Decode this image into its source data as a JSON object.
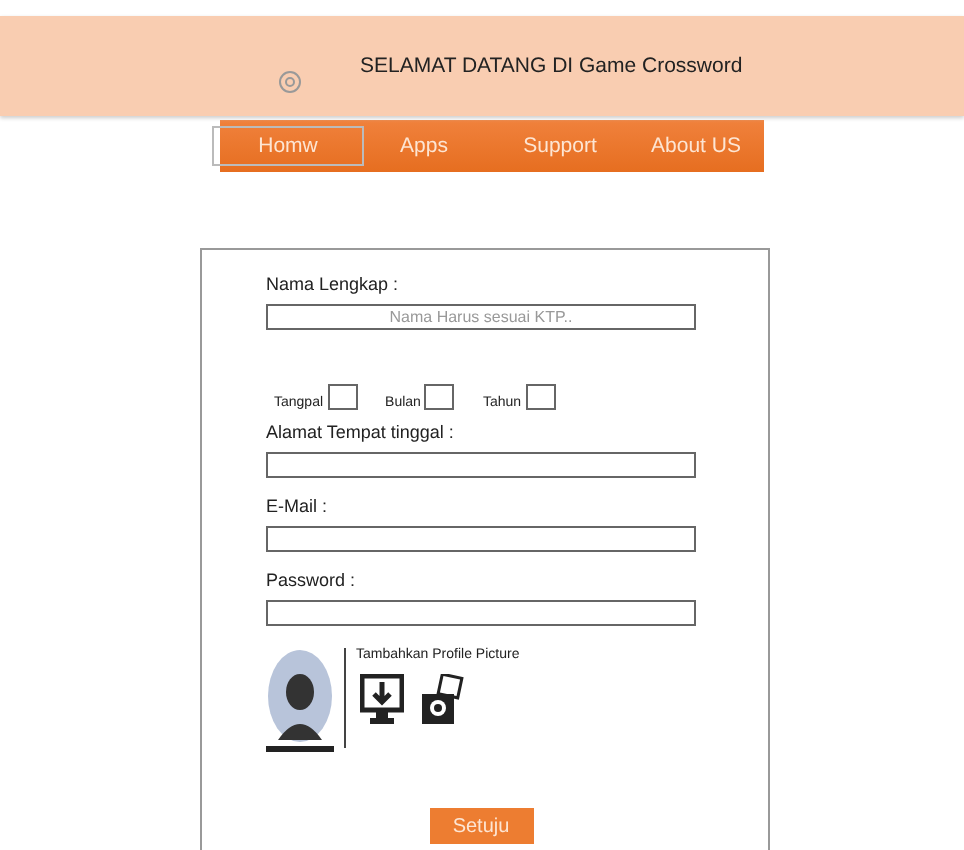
{
  "header": {
    "title": "SELAMAT DATANG DI Game Crossword"
  },
  "nav": {
    "items": [
      {
        "label": "Homw"
      },
      {
        "label": "Apps"
      },
      {
        "label": "Support"
      },
      {
        "label": "About US"
      }
    ]
  },
  "form": {
    "fields": [
      {
        "kind": "text",
        "label": "Nama Lengkap :",
        "placeholder": "Nama Harus sesuai KTP.."
      },
      {
        "kind": "date",
        "parts": [
          "Tangpal",
          "Bulan",
          "Tahun"
        ]
      },
      {
        "kind": "text",
        "label": "Alamat Tempat tinggal :"
      },
      {
        "kind": "text",
        "label": "E-Mail :"
      },
      {
        "kind": "text",
        "label": "Password :"
      }
    ],
    "profile": {
      "label": "Tambahkan Profile Picture"
    },
    "submit": "Setuju"
  }
}
